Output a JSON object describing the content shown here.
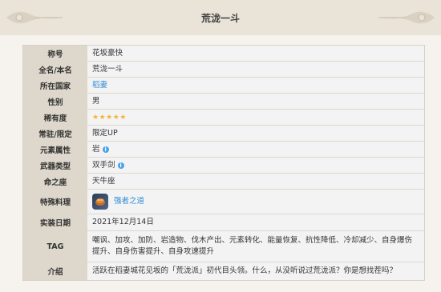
{
  "page": {
    "title": "荒泷一斗"
  },
  "profile": {
    "rows": [
      {
        "label": "称号",
        "value": "花坂豪快"
      },
      {
        "label": "全名/本名",
        "value": "荒泷一斗"
      },
      {
        "label": "所在国家",
        "value": "稻妻"
      },
      {
        "label": "性别",
        "value": "男"
      },
      {
        "label": "稀有度",
        "value": "★★★★★"
      },
      {
        "label": "常驻/限定",
        "value": "限定UP"
      },
      {
        "label": "元素属性",
        "value": "岩"
      },
      {
        "label": "武器类型",
        "value": "双手剑"
      },
      {
        "label": "命之座",
        "value": "天牛座"
      },
      {
        "label": "特殊料理",
        "value": "强者之道"
      },
      {
        "label": "实装日期",
        "value": "2021年12月14日"
      },
      {
        "label": "TAG",
        "value": "嘲讽、加攻、加防、岩造物、伐木产出、元素转化、能量恢复、抗性降低、冷却减少、自身爆伤提升、自身伤害提升、自身攻速提升"
      },
      {
        "label": "介绍",
        "value": "活跃在稻妻城花见坂的「荒泷派」初代目头领。什么，从没听说过荒泷派？你是想找茬吗？"
      }
    ]
  },
  "icons": {
    "info": "info-icon",
    "food": "dish-icon",
    "ornament": "ornament-icon"
  },
  "colors": {
    "link": "#2e8bd6",
    "label_bg": "#ddd7cc",
    "star": "#f1b53f",
    "info": "#48a3e6"
  }
}
